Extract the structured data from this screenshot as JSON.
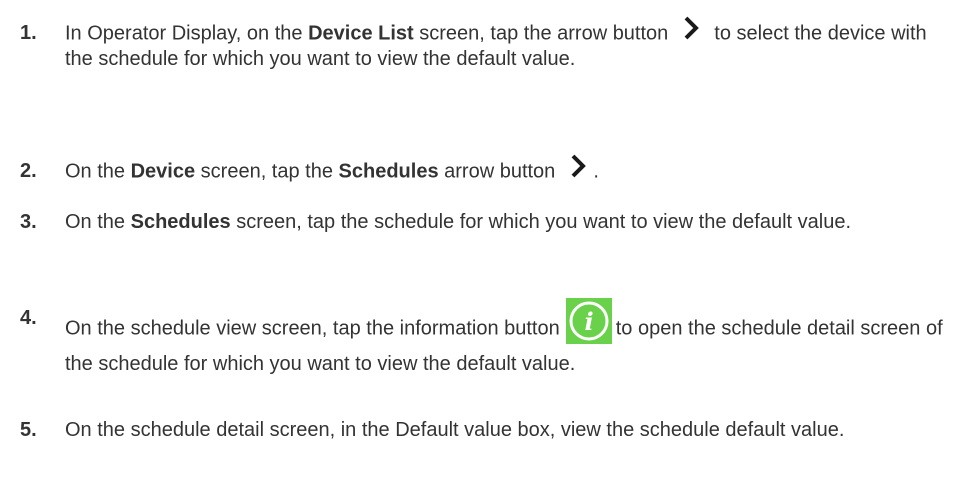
{
  "steps": [
    {
      "number": "1.",
      "parts": {
        "a": "In Operator Display, on the ",
        "b": "Device List",
        "c": " screen, tap the arrow button",
        "d": "to select the device with the schedule for which you want to view the default value."
      },
      "icon": "chevron-right-icon"
    },
    {
      "number": "2.",
      "parts": {
        "a": "On the ",
        "b": "Device",
        "c": " screen, tap the ",
        "d": "Schedules",
        "e": " arrow button",
        "f": "."
      },
      "icon": "chevron-right-icon"
    },
    {
      "number": "3.",
      "parts": {
        "a": "On the ",
        "b": "Schedules",
        "c": " screen, tap the schedule for which you want to view the default value."
      }
    },
    {
      "number": "4.",
      "parts": {
        "a": "On the schedule view screen, tap the information button",
        "b": "to open the schedule detail screen of the schedule for which you want to view the default value."
      },
      "icon": "info-icon",
      "icon_color": "#6ad14a"
    },
    {
      "number": "5.",
      "parts": {
        "a": "On the schedule detail screen, in the Default value box, view the schedule default value."
      }
    }
  ],
  "colors": {
    "text": "#333333",
    "info_green": "#6ad14a",
    "info_green_border": "#4cb832",
    "arrow": "#1a1a1a"
  }
}
